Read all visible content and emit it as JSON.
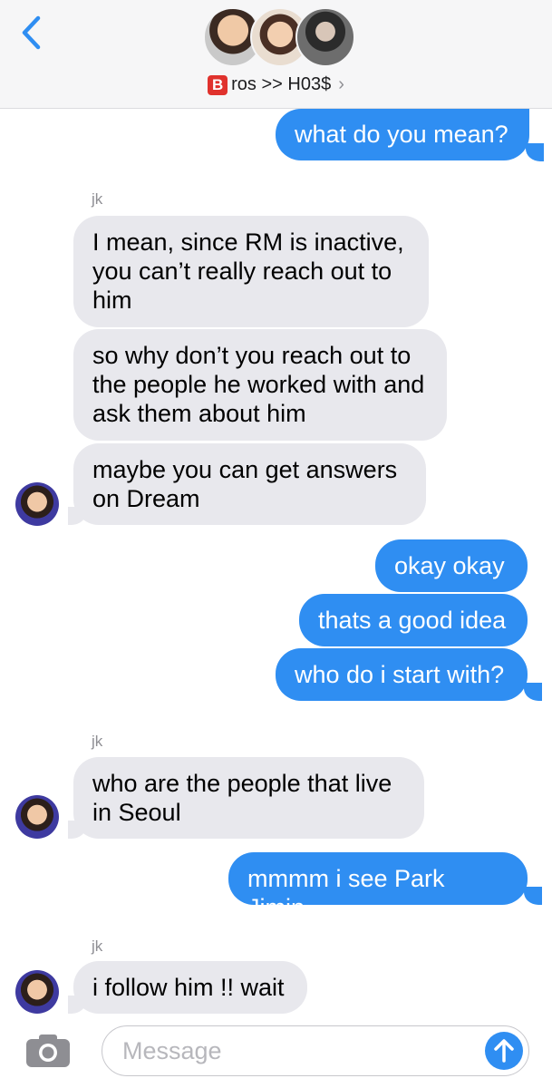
{
  "header": {
    "group_prefix_letter": "B",
    "group_name": "ros >> H03$",
    "chevron": "›",
    "back_icon": "chevron-left-icon",
    "avatars": [
      "avatar-1",
      "avatar-2",
      "avatar-3"
    ]
  },
  "messages": [
    {
      "direction": "outgoing",
      "text": "what do you mean?"
    },
    {
      "direction": "incoming",
      "sender": "jk",
      "text": "I mean, since RM is inactive, you can’t really reach out to him"
    },
    {
      "direction": "incoming",
      "text": "so why don’t you reach out to the people he worked with and ask them about him"
    },
    {
      "direction": "incoming",
      "text": "maybe you can get answers on Dream"
    },
    {
      "direction": "outgoing",
      "text": "okay okay"
    },
    {
      "direction": "outgoing",
      "text": "thats a good idea"
    },
    {
      "direction": "outgoing",
      "text": "who do i start with?"
    },
    {
      "direction": "incoming",
      "sender": "jk",
      "text": "who are the people that live in Seoul"
    },
    {
      "direction": "outgoing",
      "text": "mmmm i see Park Jimin"
    },
    {
      "direction": "incoming",
      "sender": "jk",
      "text": "i follow him !! wait"
    }
  ],
  "composer": {
    "placeholder": "Message",
    "camera_icon": "camera-icon",
    "send_icon": "arrow-up-icon"
  },
  "colors": {
    "outgoing_bubble": "#2f8ef2",
    "incoming_bubble": "#e8e8ed",
    "accent": "#2f8ef2"
  }
}
